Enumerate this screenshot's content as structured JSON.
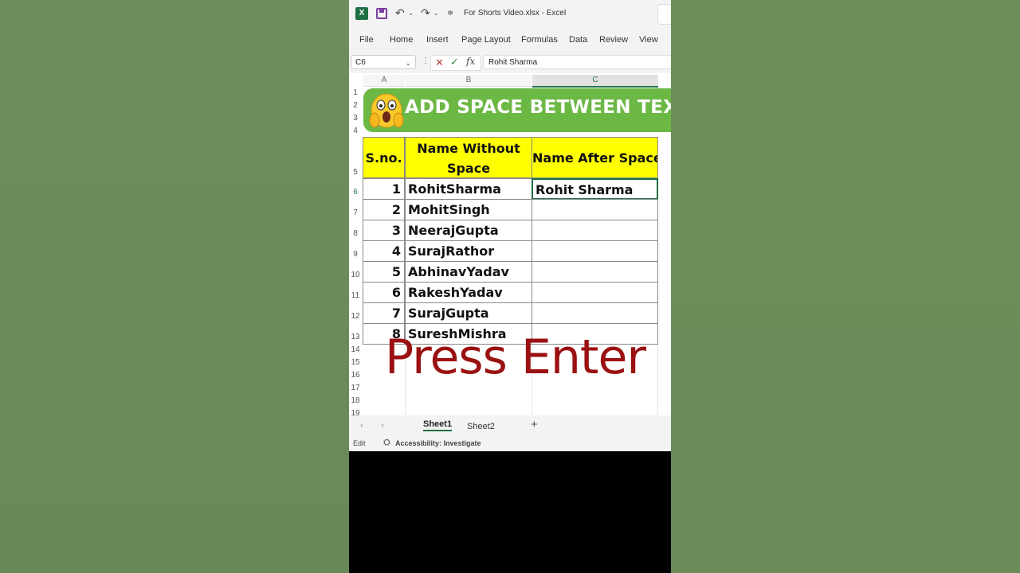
{
  "titlebar": {
    "app_logo": "X",
    "file_title": "For Shorts Video.xlsx",
    "app_name": "Excel",
    "separator": "-"
  },
  "ribbon": {
    "tabs": [
      "File",
      "Home",
      "Insert",
      "Page Layout",
      "Formulas",
      "Data",
      "Review",
      "View"
    ]
  },
  "formula_bar": {
    "name_box": "C6",
    "fx_label": "fx",
    "formula": "Rohit Sharma"
  },
  "columns": [
    "A",
    "B",
    "C"
  ],
  "rows": [
    "1",
    "2",
    "3",
    "4",
    "5",
    "6",
    "7",
    "8",
    "9",
    "10",
    "11",
    "12",
    "13",
    "14",
    "15",
    "16",
    "17",
    "18",
    "19"
  ],
  "banner": {
    "text": "ADD SPACE BETWEEN TEXT",
    "emoji": "shocked-face-icon",
    "color": "#6cb845"
  },
  "table": {
    "headers": [
      "S.no.",
      "Name Without Space",
      "Name After Space"
    ],
    "header_color": "#ffff00",
    "rows": [
      {
        "sno": "1",
        "without": "RohitSharma",
        "after": "Rohit Sharma"
      },
      {
        "sno": "2",
        "without": "MohitSingh",
        "after": ""
      },
      {
        "sno": "3",
        "without": "NeerajGupta",
        "after": ""
      },
      {
        "sno": "4",
        "without": "SurajRathor",
        "after": ""
      },
      {
        "sno": "5",
        "without": "AbhinavYadav",
        "after": ""
      },
      {
        "sno": "6",
        "without": "RakeshYadav",
        "after": ""
      },
      {
        "sno": "7",
        "without": "SurajGupta",
        "after": ""
      },
      {
        "sno": "8",
        "without": "SureshMishra",
        "after": ""
      }
    ]
  },
  "overlay": {
    "text": "Press Enter",
    "color": "#9b1111"
  },
  "sheet_tabs": [
    "Sheet1",
    "Sheet2"
  ],
  "status_bar": {
    "mode": "Edit",
    "accessibility": "Accessibility: Investigate"
  }
}
